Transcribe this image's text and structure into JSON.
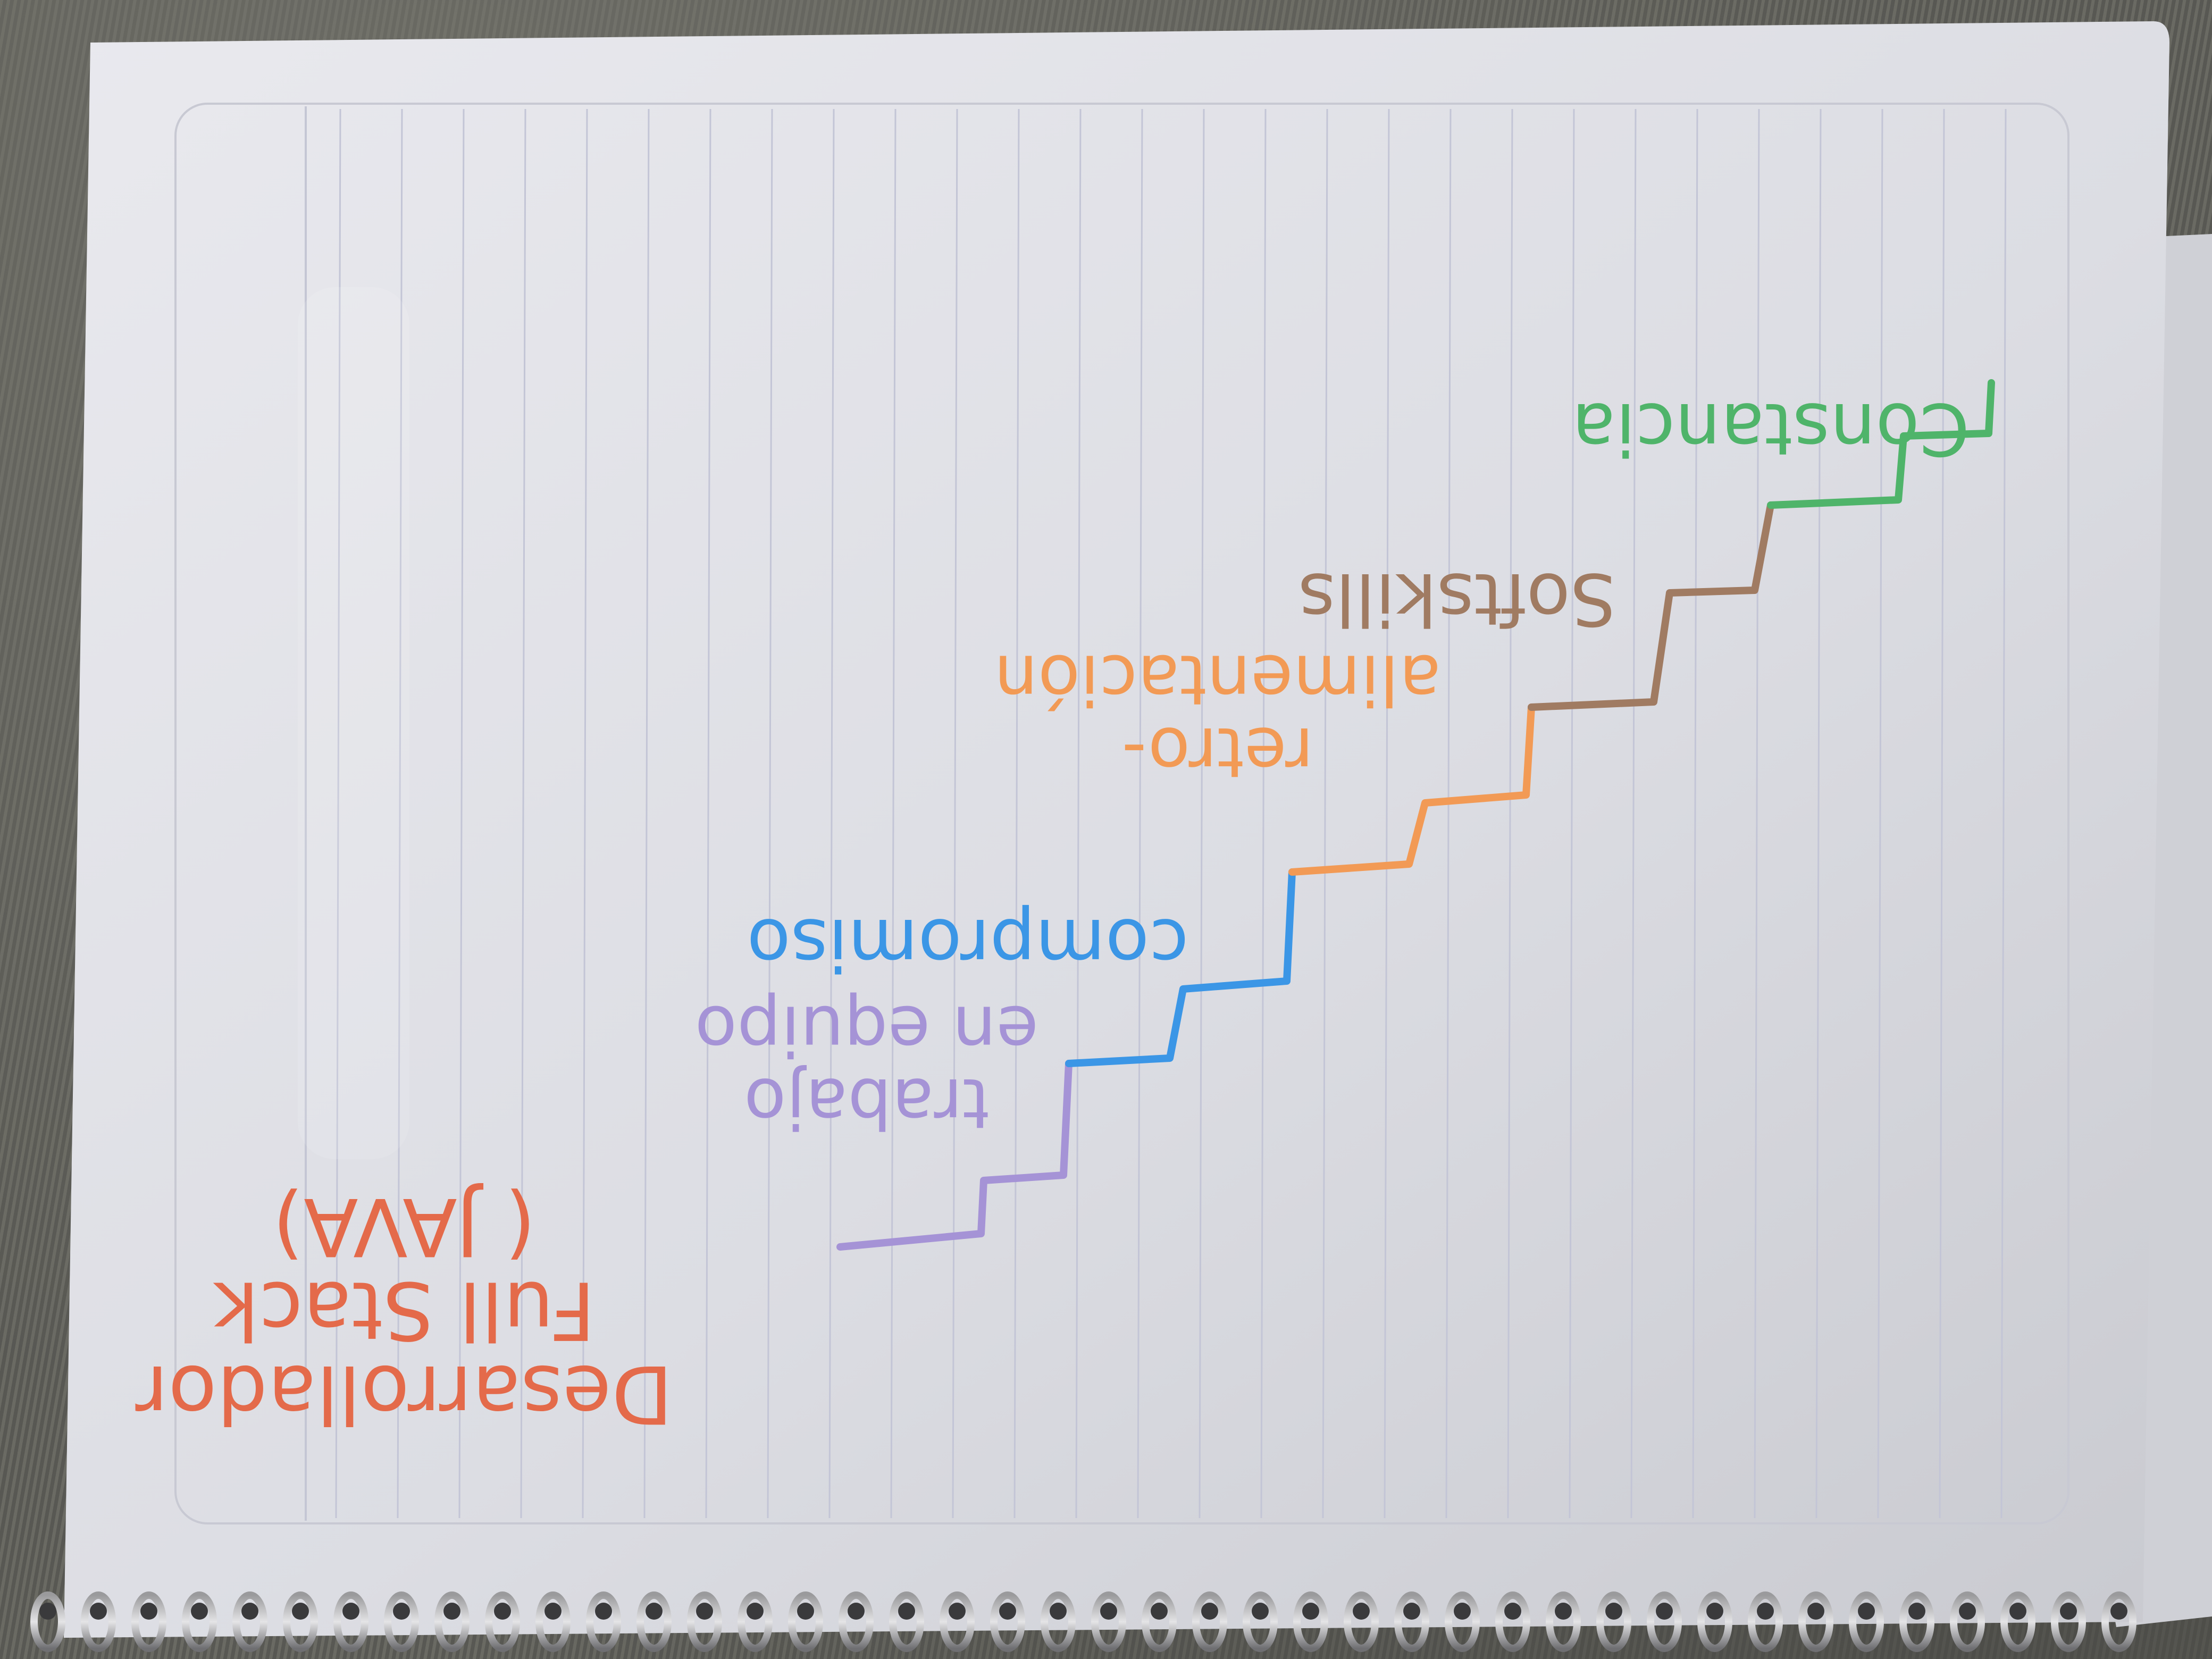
{
  "notebook": {
    "title_lines": [
      "Desarrollador",
      "Full Stack",
      "( JAVA)"
    ],
    "steps": [
      {
        "label_lines": [
          "trabajo",
          "en equipo"
        ],
        "color": "#a593d6"
      },
      {
        "label_lines": [
          "compromiso"
        ],
        "color": "#3b96e6"
      },
      {
        "label_lines": [
          "retro-",
          "alimentación"
        ],
        "color": "#f29a55"
      },
      {
        "label_lines": [
          "Softskills"
        ],
        "color": "#a07b62"
      },
      {
        "label_lines": [
          "Constancia"
        ],
        "color": "#4fb46a"
      }
    ],
    "title_color": "#e46a4a"
  }
}
